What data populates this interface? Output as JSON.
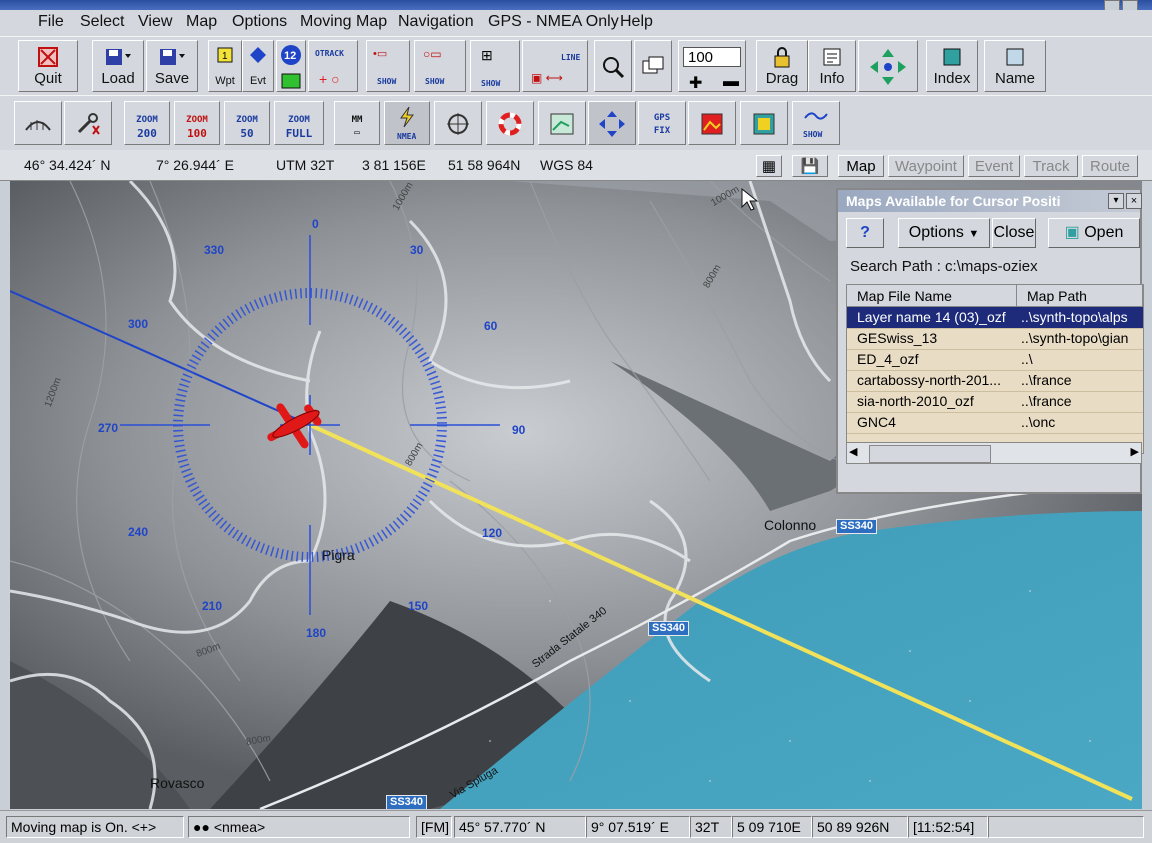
{
  "menu": [
    "File",
    "Select",
    "View",
    "Map",
    "Options",
    "Moving Map",
    "Navigation",
    "GPS - NMEA Only",
    "Help"
  ],
  "toolbar1": {
    "quit": "Quit",
    "load": "Load",
    "save": "Save",
    "wpt": "Wpt",
    "evt": "Evt",
    "track_num": "12",
    "otrack": "OTRACK",
    "show": "SHOW",
    "line": "LINE",
    "zoom_value": "100",
    "drag": "Drag",
    "info": "Info",
    "index": "Index",
    "name": "Name"
  },
  "toolbar2": {
    "zoom_prefix": "ZOOM",
    "zoom_200": "200",
    "zoom_100": "100",
    "zoom_50": "50",
    "zoom_full": "FULL",
    "mm": "MM",
    "nmea": "NMEA",
    "gps_fix_1": "GPS",
    "gps_fix_2": "FIX",
    "show": "SHOW"
  },
  "coords": {
    "lat": "46° 34.424´ N",
    "lon": "7° 26.944´ E",
    "utm": "UTM 32T",
    "east": "3 81 156E",
    "north": "51 58 964N",
    "datum": "WGS 84",
    "tabs": [
      "Map",
      "Waypoint",
      "Event",
      "Track",
      "Route"
    ]
  },
  "map": {
    "places": {
      "pigra": "Pigra",
      "colonno": "Colonno",
      "rovasco": "Rovasco"
    },
    "roads": {
      "ss340_a": "SS340",
      "ss340_b": "SS340",
      "ss340_c": "SS340",
      "strada": "Strada Statale 340",
      "spluga": "Via Spluga"
    },
    "contours": {
      "c1000a": "1000m",
      "c1000b": "1000m",
      "c800a": "800m",
      "c800b": "800m",
      "c800c": "800m",
      "c800d": "800m",
      "c1200": "1200m"
    },
    "compass": [
      "0",
      "30",
      "60",
      "90",
      "120",
      "150",
      "180",
      "210",
      "240",
      "270",
      "300",
      "330"
    ],
    "colors": {
      "track": "#f2e25a",
      "heading": "#1f44c8",
      "aircraft": "#e01818"
    }
  },
  "mappanel": {
    "title": "Maps Available for Cursor Positi",
    "options": "Options",
    "close": "Close",
    "open": "Open",
    "help": "?",
    "search_path": "Search Path :  c:\\maps-oziex",
    "col_file": "Map File Name",
    "col_path": "Map Path",
    "rows": [
      {
        "file": "Layer name 14 (03)_ozf",
        "path": "..\\synth-topo\\alps"
      },
      {
        "file": "GESwiss_13",
        "path": "..\\synth-topo\\gian"
      },
      {
        "file": "ED_4_ozf",
        "path": "..\\"
      },
      {
        "file": "cartabossy-north-201...",
        "path": "..\\france"
      },
      {
        "file": "sia-north-2010_ozf",
        "path": "..\\france"
      },
      {
        "file": "GNC4",
        "path": "..\\onc"
      }
    ]
  },
  "status": {
    "moving": "Moving map is On. <+>",
    "nmea": "<nmea>",
    "fm": "[FM]",
    "lat": "45° 57.770´ N",
    "lon": "9° 07.519´ E",
    "zone": "32T",
    "east": "5 09 710E",
    "north": "50 89 926N",
    "time": "[11:52:54]"
  }
}
